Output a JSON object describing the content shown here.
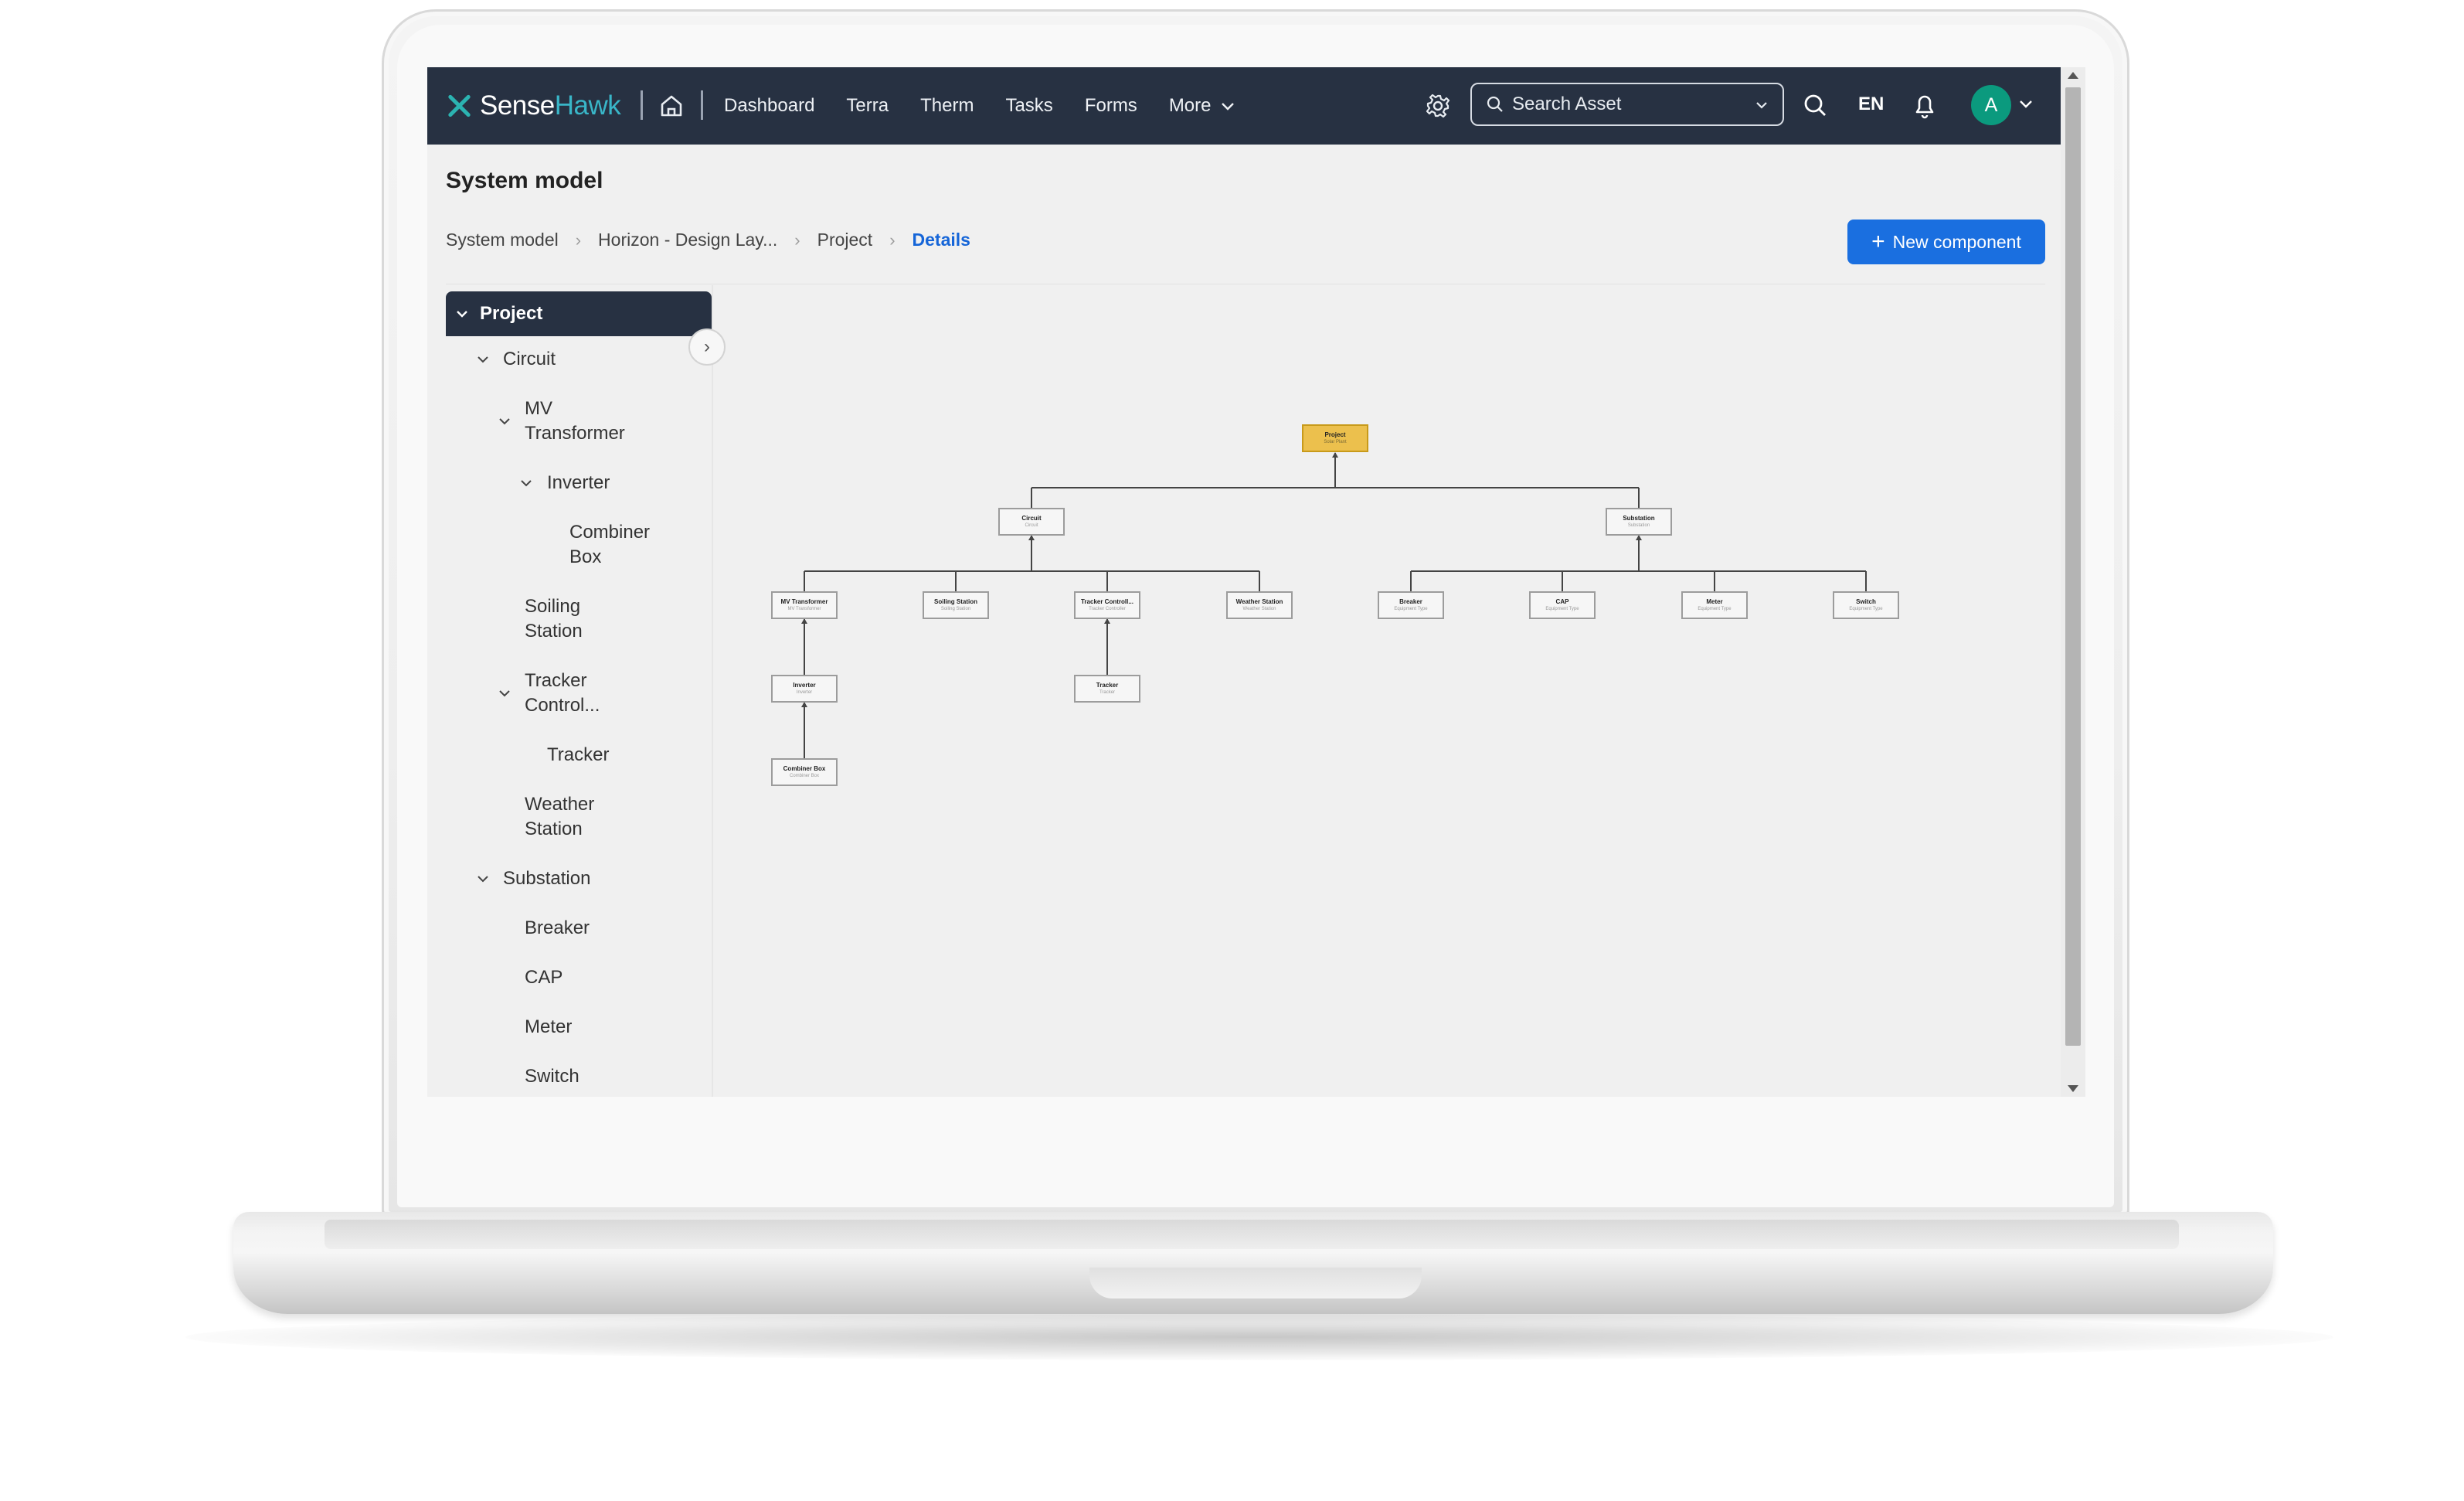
{
  "app": {
    "logo_text_primary": "Sense",
    "logo_text_accent": "Hawk",
    "brand_accent": "#39b6c8",
    "topbar_color": "#273142"
  },
  "nav": {
    "items": [
      "Dashboard",
      "Terra",
      "Therm",
      "Tasks",
      "Forms"
    ],
    "more_label": "More"
  },
  "search": {
    "placeholder": "Search Asset"
  },
  "header": {
    "lang": "EN",
    "avatar_initial": "A",
    "avatar_color": "#0b9a7e"
  },
  "page": {
    "title": "System model",
    "breadcrumb": [
      "System model",
      "Horizon - Design Lay...",
      "Project",
      "Details"
    ],
    "new_component_label": "New component"
  },
  "tree": {
    "root": "Project",
    "items": [
      {
        "label": "Circuit"
      },
      {
        "label_line1": "MV",
        "label_line2": "Transformer"
      },
      {
        "label": "Inverter"
      },
      {
        "label_line1": "Combiner",
        "label_line2": "Box"
      },
      {
        "label_line1": "Soiling",
        "label_line2": "Station"
      },
      {
        "label_line1": "Tracker",
        "label_line2": "Control..."
      },
      {
        "label": "Tracker"
      },
      {
        "label_line1": "Weather",
        "label_line2": "Station"
      },
      {
        "label": "Substation"
      },
      {
        "label": "Breaker"
      },
      {
        "label": "CAP"
      },
      {
        "label": "Meter"
      },
      {
        "label": "Switch"
      }
    ]
  },
  "diagram": {
    "nodes": {
      "project": {
        "title": "Project",
        "subtitle": "Solar Plant"
      },
      "circuit": {
        "title": "Circuit",
        "subtitle": "Circuit"
      },
      "substation": {
        "title": "Substation",
        "subtitle": "Substation"
      },
      "mv": {
        "title": "MV Transformer",
        "subtitle": "MV Transformer"
      },
      "soiling": {
        "title": "Soiling Station",
        "subtitle": "Soiling Station"
      },
      "trackerctl": {
        "title": "Tracker Controll...",
        "subtitle": "Tracker Controller"
      },
      "weather": {
        "title": "Weather Station",
        "subtitle": "Weather Station"
      },
      "breaker": {
        "title": "Breaker",
        "subtitle": "Equipment Type"
      },
      "cap": {
        "title": "CAP",
        "subtitle": "Equipment Type"
      },
      "meter": {
        "title": "Meter",
        "subtitle": "Equipment Type"
      },
      "switch": {
        "title": "Switch",
        "subtitle": "Equipment Type"
      },
      "inverter": {
        "title": "Inverter",
        "subtitle": "Inverter"
      },
      "tracker": {
        "title": "Tracker",
        "subtitle": "Tracker"
      },
      "combiner": {
        "title": "Combiner Box",
        "subtitle": "Combiner Box"
      }
    }
  }
}
